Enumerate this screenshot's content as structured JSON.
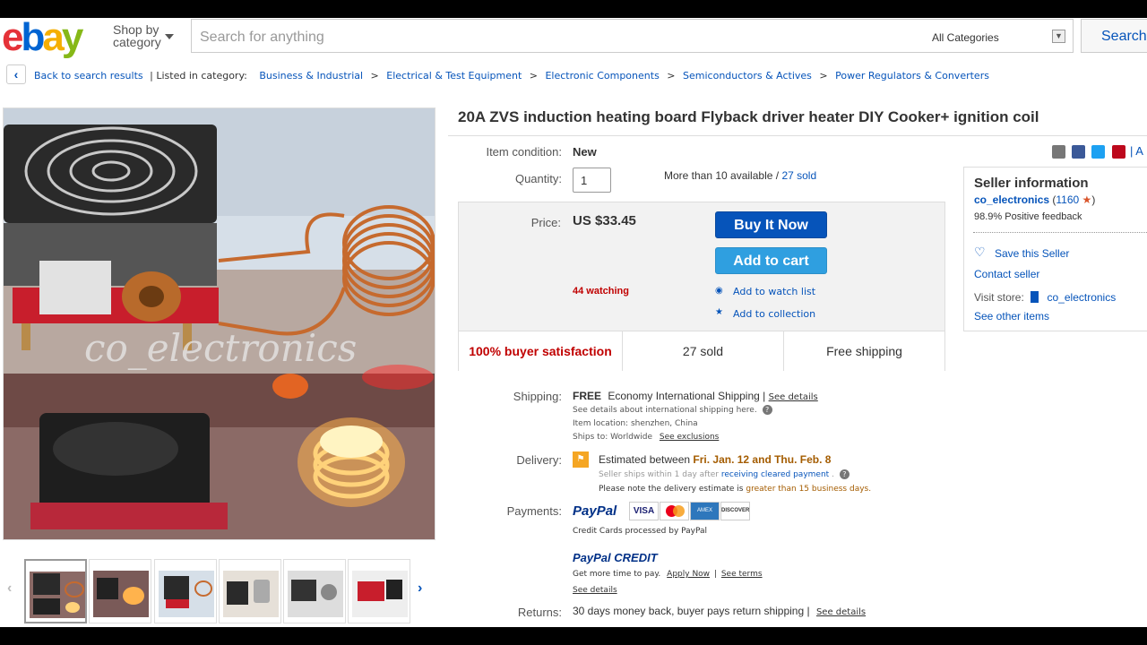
{
  "header": {
    "logo": {
      "e": "e",
      "b": "b",
      "a": "a",
      "y": "y"
    },
    "shop_by": "Shop by",
    "category": "category",
    "search_placeholder": "Search for anything",
    "all_categories": "All Categories",
    "search_button": "Search"
  },
  "breadcrumb": {
    "back": "Back to search results",
    "listed_in": "| Listed in category:",
    "items": [
      "Business & Industrial",
      "Electrical & Test Equipment",
      "Electronic Components",
      "Semiconductors & Actives",
      "Power Regulators & Converters"
    ],
    "sep": ">"
  },
  "image": {
    "watermark": "co_electronics"
  },
  "item": {
    "title": "20A ZVS induction heating board Flyback driver heater DIY Cooker+ ignition coil",
    "condition_label": "Item condition:",
    "condition": "New",
    "quantity_label": "Quantity:",
    "quantity": "1",
    "available": "More than 10 available /",
    "sold_link": "27 sold",
    "share_more": "| A"
  },
  "buybox": {
    "price_label": "Price:",
    "price": "US $33.45",
    "buy_now": "Buy It Now",
    "add_to_cart": "Add to cart",
    "watching": "44 watching",
    "watch_list": "Add to watch list",
    "collection": "Add to collection",
    "satisfaction": "100% buyer satisfaction",
    "sold": "27 sold",
    "free_shipping": "Free shipping"
  },
  "shipping": {
    "label": "Shipping:",
    "free": "FREE",
    "method": "Economy International Shipping |",
    "see_details": "See details",
    "intl_note": "See details about international shipping here.",
    "location_label": "Item location:",
    "location": "shenzhen, China",
    "ships_to_label": "Ships to:",
    "ships_to": "Worldwide",
    "exclusions": "See exclusions"
  },
  "delivery": {
    "label": "Delivery:",
    "estimated": "Estimated between",
    "dates": "Fri. Jan. 12 and Thu. Feb. 8",
    "handling_a": "Seller ships within 1 day after",
    "handling_link": "receiving cleared payment",
    "handling_dot": ".",
    "note_a": "Please note the delivery estimate is",
    "note_b": "greater than 15 business days."
  },
  "payments": {
    "label": "Payments:",
    "paypal": "PayPal",
    "cards": [
      "VISA",
      "MC",
      "AMEX",
      "DISCOVER"
    ],
    "processed": "Credit Cards processed by PayPal",
    "credit": "PayPal CREDIT",
    "more_time": "Get more time to pay.",
    "apply": "Apply Now",
    "pipe": "|",
    "terms": "See terms",
    "see_details": "See details"
  },
  "returns": {
    "label": "Returns:",
    "text": "30 days money back, buyer pays return shipping |",
    "see_details": "See details"
  },
  "seller": {
    "heading": "Seller information",
    "name": "co_electronics",
    "score": "1160",
    "feedback": "98.9% Positive feedback",
    "save": "Save this Seller",
    "contact": "Contact seller",
    "visit_label": "Visit store:",
    "store": "co_electronics",
    "other": "See other items"
  },
  "colors": {
    "accent": "#0654ba",
    "price_red": "#c00000",
    "delivery_brown": "#a45c00"
  }
}
